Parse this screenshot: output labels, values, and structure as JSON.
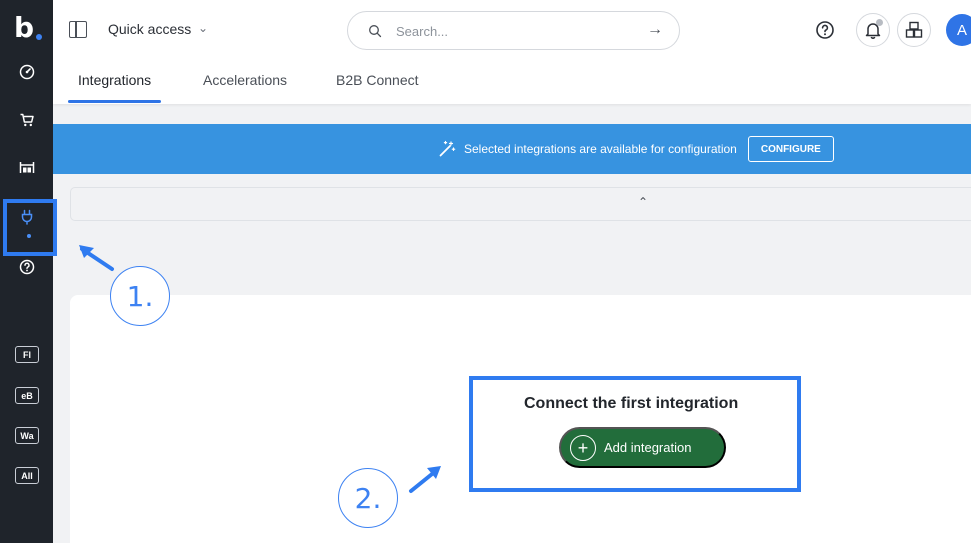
{
  "sidebar": {
    "logo": "b",
    "chips": [
      "Fl",
      "eB",
      "Wa",
      "All"
    ]
  },
  "header": {
    "quick_access": "Quick access",
    "search": {
      "placeholder": "Search..."
    },
    "avatar_initial": "A"
  },
  "tabs": [
    {
      "label": "Integrations",
      "active": true
    },
    {
      "label": "Accelerations",
      "active": false
    },
    {
      "label": "B2B Connect",
      "active": false
    }
  ],
  "banner": {
    "message": "Selected integrations are available for configuration",
    "button": "CONFIGURE"
  },
  "empty_state": {
    "title": "Connect the first integration",
    "button": "Add integration"
  },
  "annotations": {
    "step1": "1.",
    "step2": "2."
  },
  "colors": {
    "sidebar": "#1f242b",
    "accent": "#2f74e6",
    "banner": "#3793e0",
    "add_button": "#226d3b",
    "annotation": "#2f7bf0"
  }
}
